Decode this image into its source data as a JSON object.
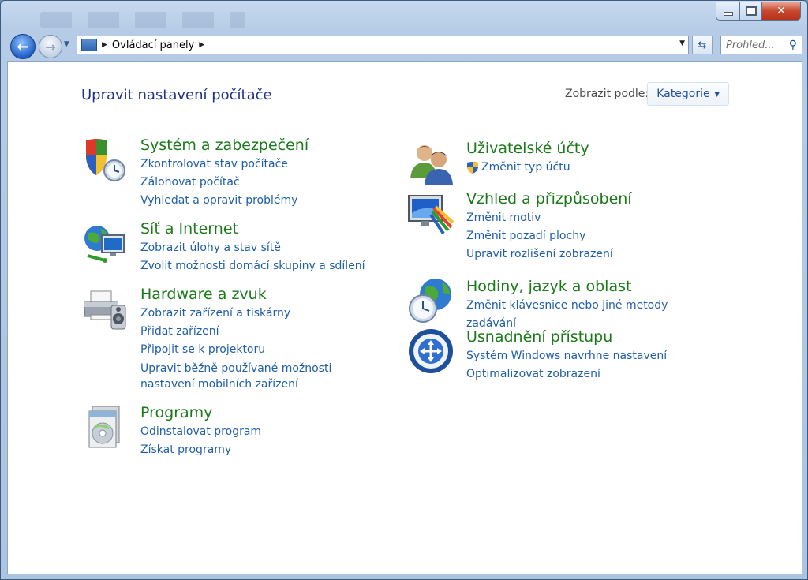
{
  "window": {
    "close_glyph": "✕"
  },
  "nav": {
    "back_glyph": "←",
    "forward_glyph": "→",
    "address_root_sep": "▶",
    "address": "Ovládací panely",
    "address_trail_sep": "▶",
    "refresh_glyph": "⇆",
    "search_placeholder": "Prohled...",
    "search_glyph": "⚲"
  },
  "header": {
    "title": "Upravit nastavení počítače",
    "view_label": "Zobrazit podle:",
    "view_value": "Kategorie"
  },
  "categories": [
    {
      "title": "Systém a zabezpečení",
      "icon": "security-shield-clock-icon",
      "links": [
        "Zkontrolovat stav počítače",
        "Zálohovat počítač",
        "Vyhledat a opravit problémy"
      ]
    },
    {
      "title": "Síť a Internet",
      "icon": "network-globe-icon",
      "links": [
        "Zobrazit úlohy a stav sítě",
        "Zvolit možnosti domácí skupiny a sdílení"
      ]
    },
    {
      "title": "Hardware a zvuk",
      "icon": "printer-speaker-icon",
      "links": [
        "Zobrazit zařízení a tiskárny",
        "Přidat zařízení",
        "Připojit se k projektoru",
        "Upravit běžně používané možnosti nastavení mobilních zařízení"
      ]
    },
    {
      "title": "Programy",
      "icon": "programs-disc-icon",
      "links": [
        "Odinstalovat program",
        "Získat programy"
      ]
    },
    {
      "title": "Uživatelské účty",
      "icon": "users-icon",
      "links": [
        "Změnit typ účtu"
      ]
    },
    {
      "title": "Vzhled a přizpůsobení",
      "icon": "monitor-palette-icon",
      "links": [
        "Změnit motiv",
        "Změnit pozadí plochy",
        "Upravit rozlišení zobrazení"
      ]
    },
    {
      "title": "Hodiny, jazyk a oblast",
      "icon": "globe-clock-icon",
      "links": [
        "Změnit klávesnice nebo jiné metody zadávání"
      ]
    },
    {
      "title": "Usnadnění přístupu",
      "icon": "ease-of-access-icon",
      "links": [
        "Systém Windows navrhne nastavení",
        "Optimalizovat zobrazení"
      ]
    }
  ]
}
